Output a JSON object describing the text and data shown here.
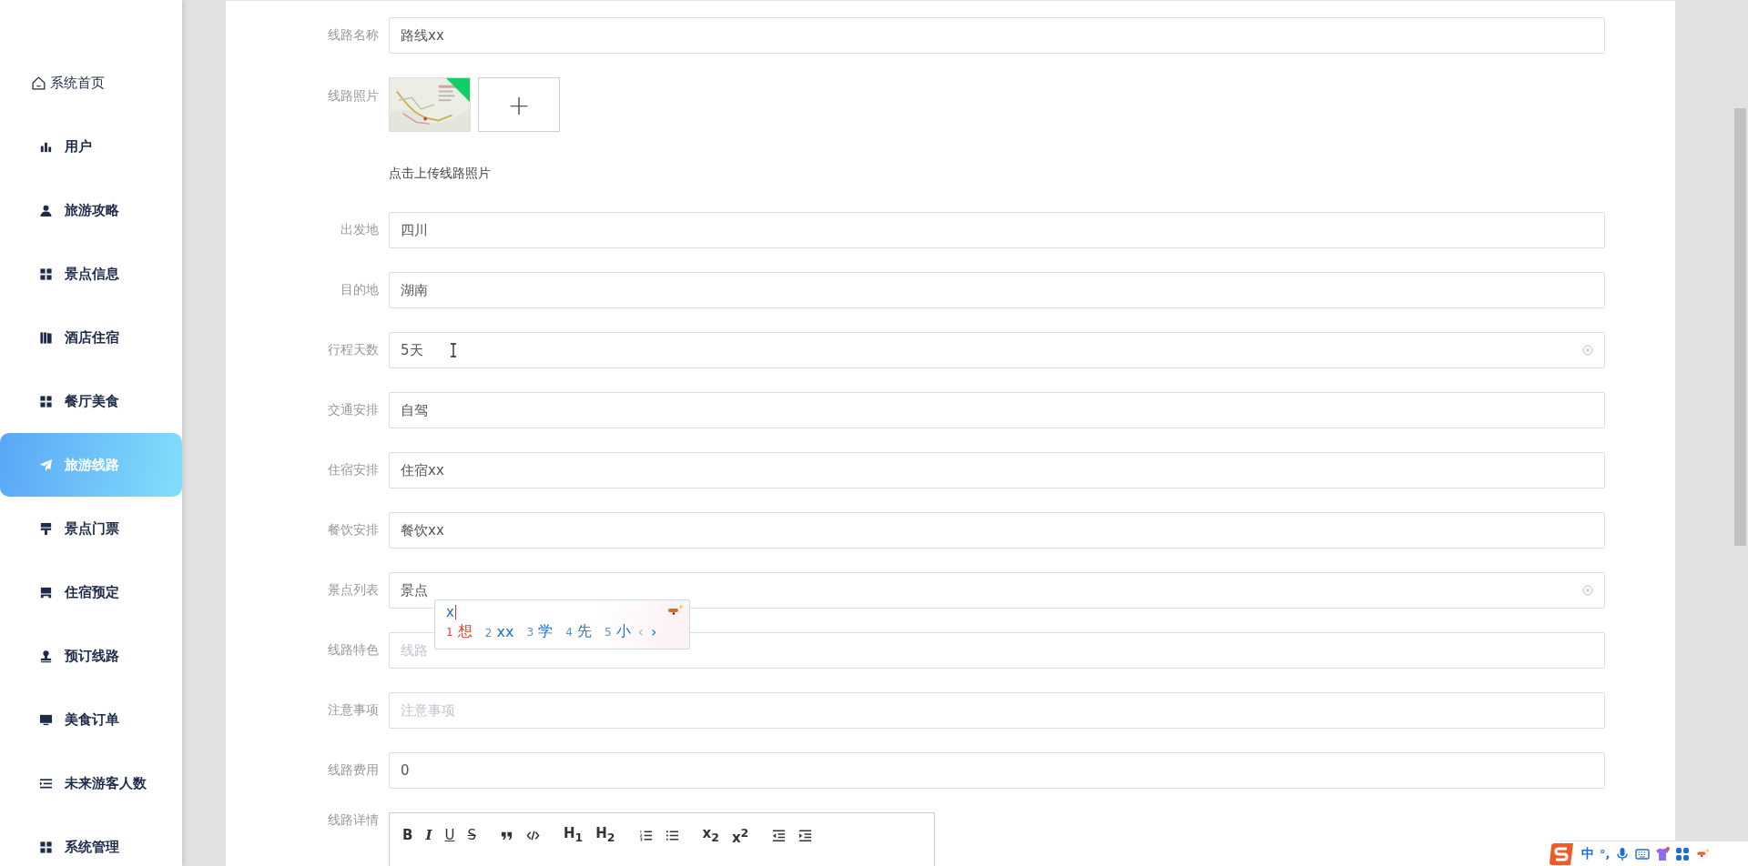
{
  "sidebar": {
    "items": [
      {
        "kind": "home",
        "label": "系统首页",
        "selected": false
      },
      {
        "kind": "menu",
        "label": "用户",
        "selected": false
      },
      {
        "kind": "menu",
        "label": "旅游攻略",
        "selected": false
      },
      {
        "kind": "menu",
        "label": "景点信息",
        "selected": false
      },
      {
        "kind": "menu",
        "label": "酒店住宿",
        "selected": false
      },
      {
        "kind": "menu",
        "label": "餐厅美食",
        "selected": false
      },
      {
        "kind": "menu",
        "label": "旅游线路",
        "selected": true
      },
      {
        "kind": "menu",
        "label": "景点门票",
        "selected": false
      },
      {
        "kind": "menu",
        "label": "住宿预定",
        "selected": false
      },
      {
        "kind": "menu",
        "label": "预订线路",
        "selected": false
      },
      {
        "kind": "menu",
        "label": "美食订单",
        "selected": false
      },
      {
        "kind": "menu",
        "label": "未来游客人数",
        "selected": false
      },
      {
        "kind": "menu",
        "label": "系统管理",
        "selected": false
      }
    ]
  },
  "form": {
    "fields": [
      {
        "kind": "input",
        "label": "线路名称",
        "value": "路线xx",
        "clearable": false
      },
      {
        "kind": "upload",
        "label": "线路照片",
        "hint": "点击上传线路照片",
        "uploaded": true,
        "add_symbol": "+"
      },
      {
        "kind": "input",
        "label": "出发地",
        "value": "四川",
        "clearable": false
      },
      {
        "kind": "input",
        "label": "目的地",
        "value": "湖南",
        "clearable": false
      },
      {
        "kind": "input",
        "label": "行程天数",
        "value": "5天",
        "clearable": true,
        "text_cursor": true
      },
      {
        "kind": "input",
        "label": "交通安排",
        "value": "自驾",
        "clearable": false
      },
      {
        "kind": "input",
        "label": "住宿安排",
        "value": "住宿xx",
        "clearable": false
      },
      {
        "kind": "input",
        "label": "餐饮安排",
        "value": "餐饮xx",
        "clearable": false
      },
      {
        "kind": "input",
        "label": "景点列表",
        "value": "景点",
        "clearable": true,
        "ime": true
      },
      {
        "kind": "input",
        "label": "线路特色",
        "placeholder": "线路",
        "clearable": false
      },
      {
        "kind": "input",
        "label": "注意事项",
        "placeholder": "注意事项",
        "clearable": false
      },
      {
        "kind": "input",
        "label": "线路费用",
        "value": "0",
        "clearable": false
      },
      {
        "kind": "editor",
        "label": "线路详情",
        "toolbar": [
          {
            "kind": "bold",
            "label": "B"
          },
          {
            "kind": "italic",
            "label": "I"
          },
          {
            "kind": "underline",
            "label": "U"
          },
          {
            "kind": "strike",
            "label": "S"
          },
          {
            "kind": "quote"
          },
          {
            "kind": "code"
          },
          {
            "kind": "heading",
            "label": "H$_{1}$"
          },
          {
            "kind": "heading",
            "label": "H$_{2}$"
          },
          {
            "kind": "ordered-list"
          },
          {
            "kind": "bullet-list"
          },
          {
            "kind": "script",
            "label": "x$_{2}$"
          },
          {
            "kind": "script",
            "label": "x$^{2}$"
          },
          {
            "kind": "outdent"
          },
          {
            "kind": "indent"
          }
        ]
      }
    ]
  },
  "ime_popup": {
    "composition": "x",
    "candidates": [
      {
        "number": "1",
        "text": "想",
        "selected": true
      },
      {
        "number": "2",
        "text": "xx",
        "selected": false
      },
      {
        "number": "3",
        "text": "学",
        "selected": false
      },
      {
        "number": "4",
        "text": "先",
        "selected": false
      },
      {
        "number": "5",
        "text": "小",
        "selected": false
      }
    ],
    "prev": {
      "text": "‹",
      "disabled": true
    },
    "next": {
      "text": "›",
      "disabled": false
    }
  },
  "ime_toolbar": {
    "mode": "中",
    "punctuation": "°,"
  }
}
